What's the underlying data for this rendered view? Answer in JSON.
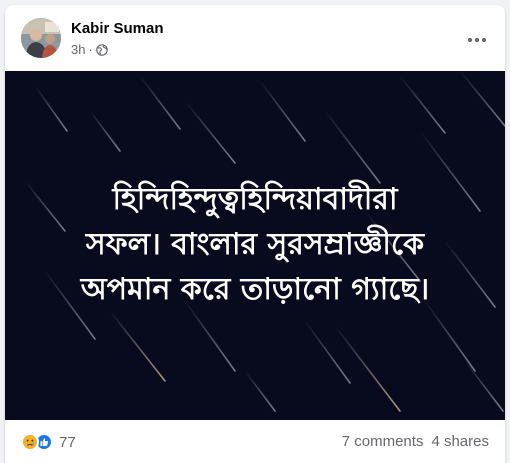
{
  "post": {
    "author": "Kabir Suman",
    "time": "3h",
    "separator": "·",
    "privacy_icon": "globe-icon",
    "menu_icon": "more-horizontal-icon",
    "text_lines": [
      "হিন্দিহিন্দুত্বহিন্দিয়াবাদীরা",
      "সফল। বাংলার সুরসম্রাজ্ঞীকে",
      "অপমান করে তাড়ানো গ্যাছে।"
    ],
    "background_color": "#080a1d"
  },
  "footer": {
    "reaction_icons": [
      "sad-reaction-icon",
      "like-reaction-icon"
    ],
    "reaction_count": "77",
    "comments": "7 comments",
    "shares": "4 shares"
  }
}
